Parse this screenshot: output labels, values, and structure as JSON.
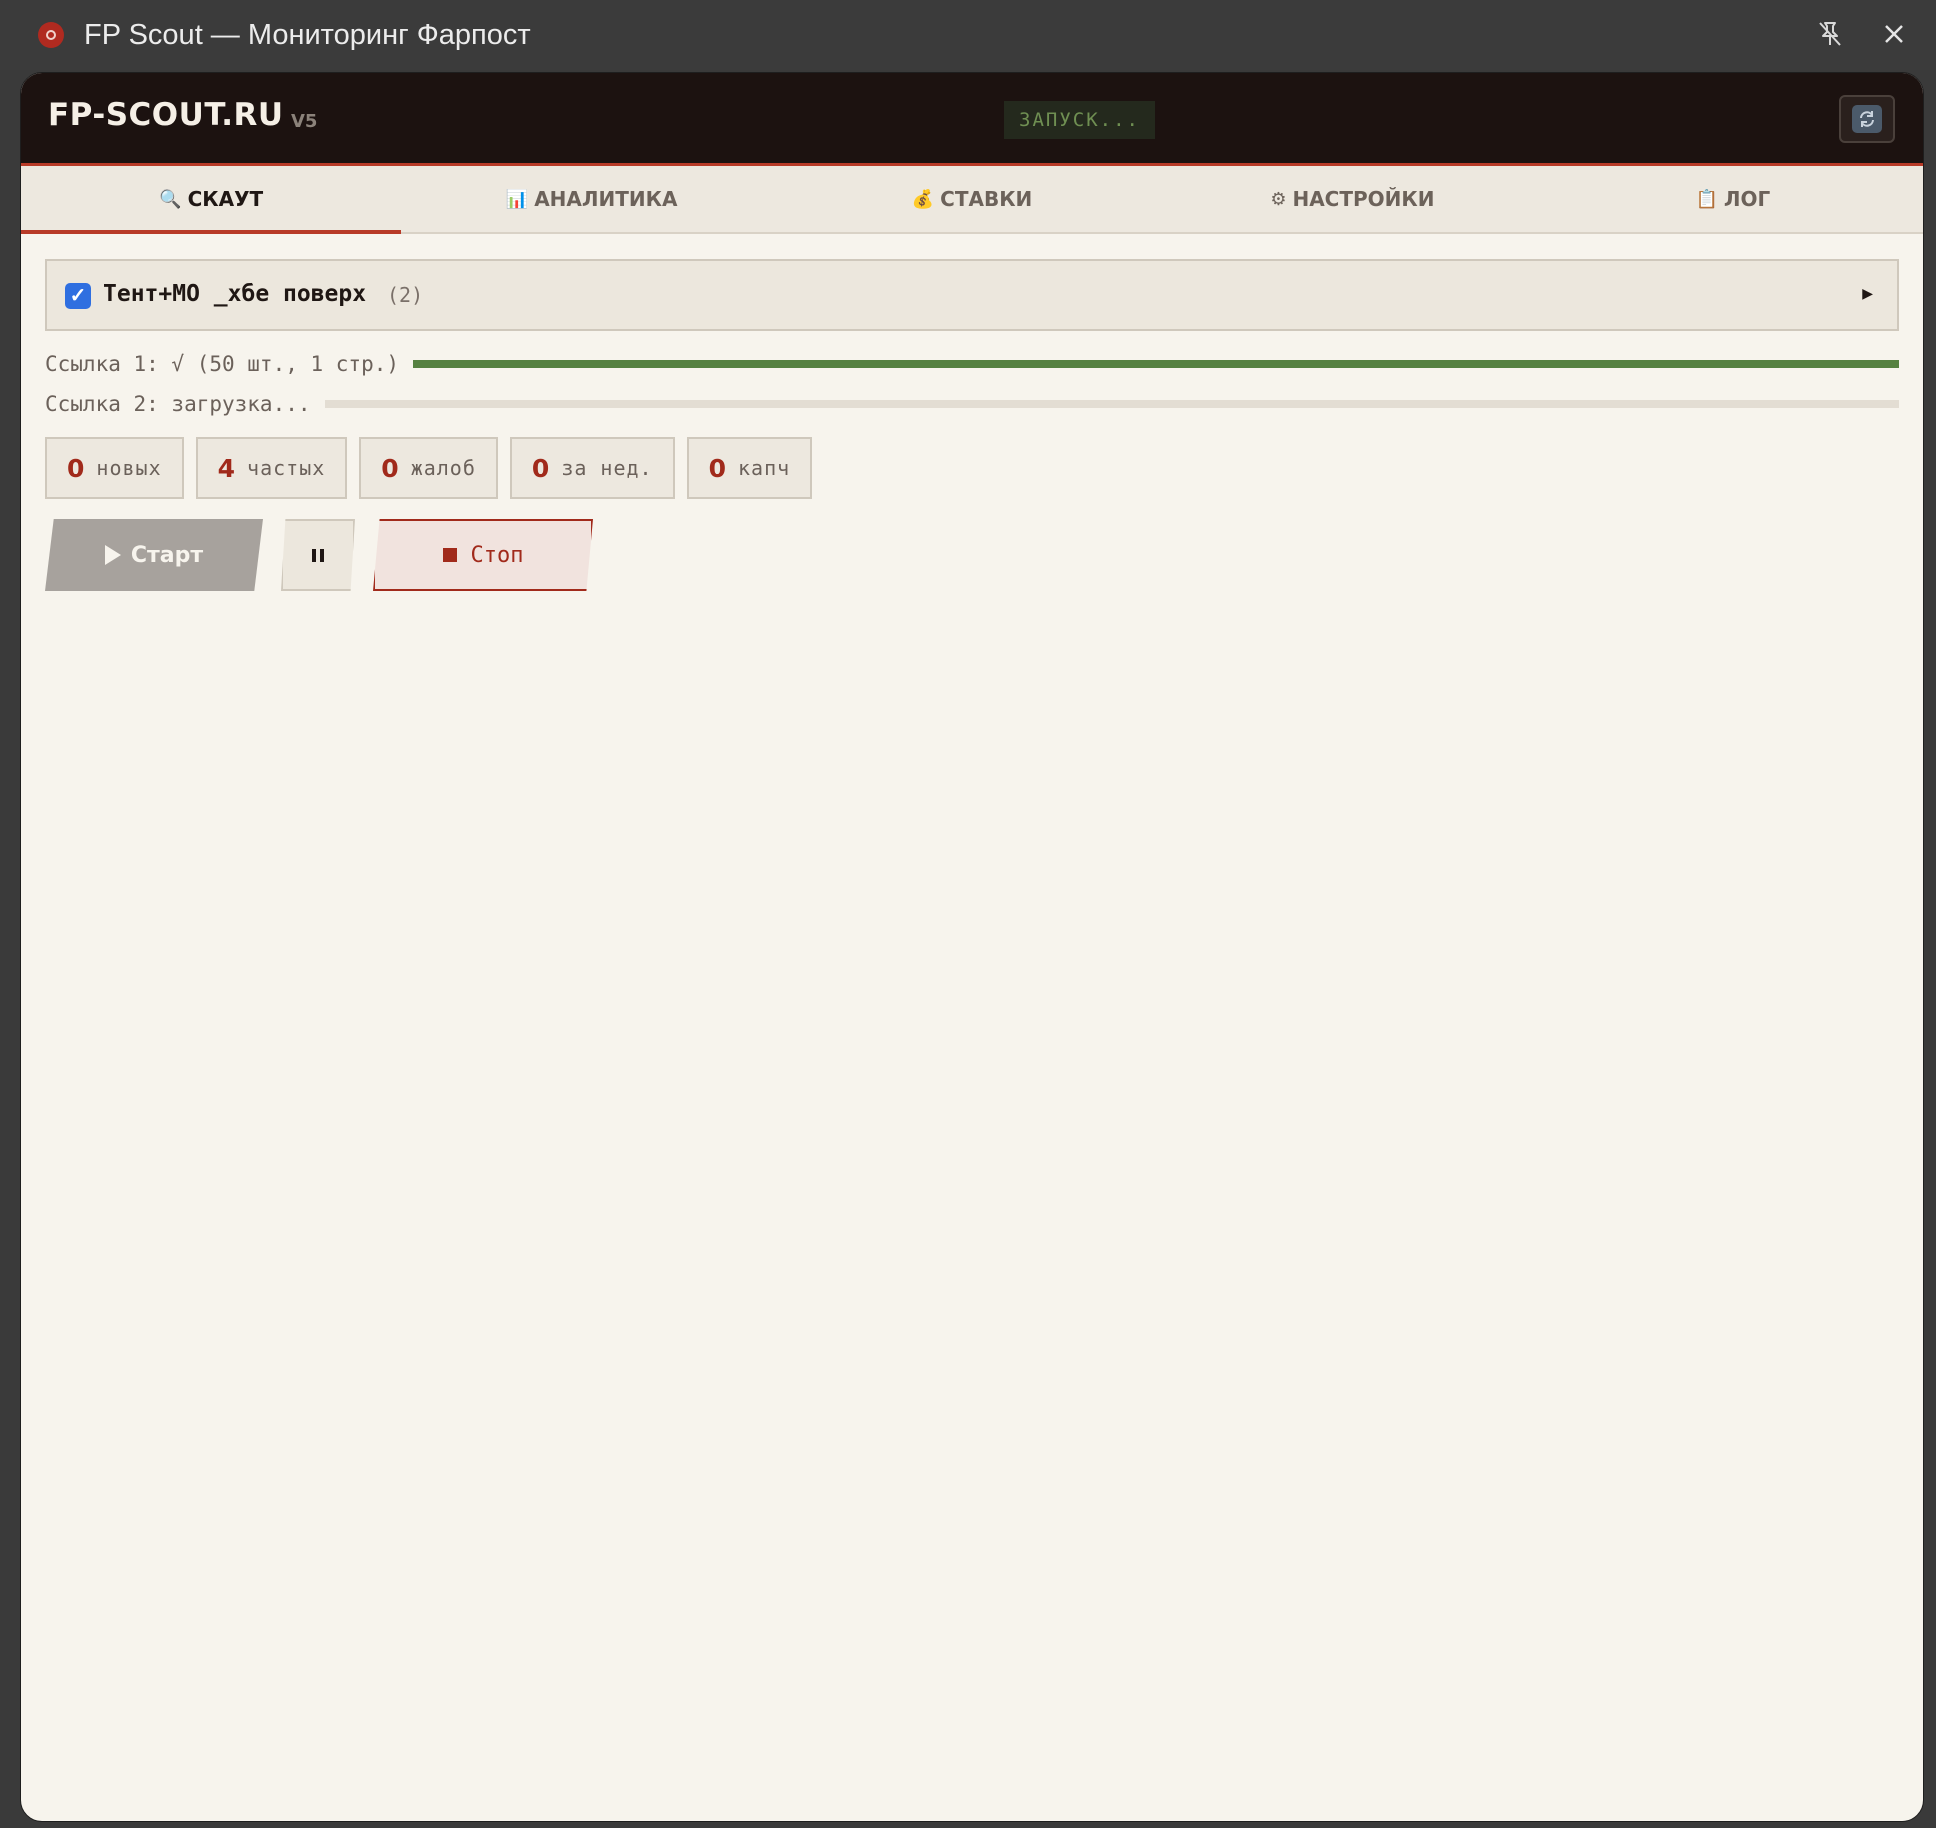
{
  "window": {
    "title": "FP Scout — Мониторинг Фарпост"
  },
  "header": {
    "brand": "FP-SCOUT.RU",
    "version": "V5",
    "status": "ЗАПУСК..."
  },
  "tabs": [
    {
      "label": "СКАУТ",
      "icon": "🔍",
      "active": true
    },
    {
      "label": "АНАЛИТИКА",
      "icon": "📊",
      "active": false
    },
    {
      "label": "СТАВКИ",
      "icon": "💰",
      "active": false
    },
    {
      "label": "НАСТРОЙКИ",
      "icon": "⚙",
      "active": false
    },
    {
      "label": "ЛОГ",
      "icon": "📋",
      "active": false
    }
  ],
  "group": {
    "checked": true,
    "name": "Тент+МО _хбе поверх",
    "count": "(2)"
  },
  "links": [
    {
      "label": "Ссылка 1: √ (50 шт., 1 стр.)",
      "progress": 1.0
    },
    {
      "label": "Ссылка 2: загрузка...",
      "progress": 0.0
    }
  ],
  "stats": [
    {
      "value": "0",
      "label": "новых"
    },
    {
      "value": "4",
      "label": "частых"
    },
    {
      "value": "0",
      "label": "жалоб"
    },
    {
      "value": "0",
      "label": "за нед."
    },
    {
      "value": "0",
      "label": "капч"
    }
  ],
  "controls": {
    "start_label": "Старт",
    "stop_label": "Стоп"
  },
  "colors": {
    "accent": "#b83b28",
    "success": "#568141",
    "stat_number": "#a12a1b"
  }
}
